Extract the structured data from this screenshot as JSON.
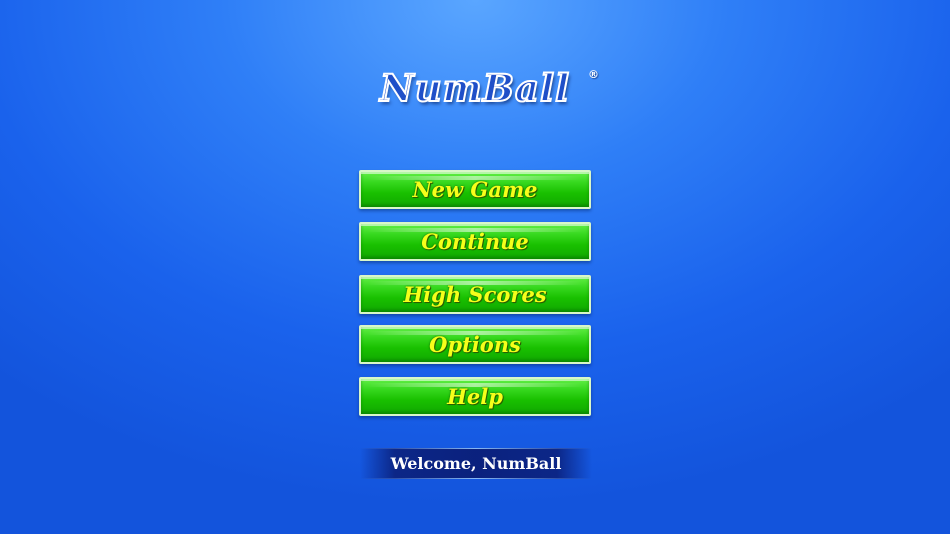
{
  "logo": {
    "title": "NumBall",
    "registered_mark": "®"
  },
  "menu": {
    "new_game": "New Game",
    "continue": "Continue",
    "high_scores": "High Scores",
    "options": "Options",
    "help": "Help"
  },
  "footer": {
    "welcome": "Welcome, NumBall"
  },
  "colors": {
    "background": "#2f7ff7",
    "button_green": "#19c000",
    "button_text": "#f6ff1a",
    "welcome_bar": "#0a1e78"
  }
}
